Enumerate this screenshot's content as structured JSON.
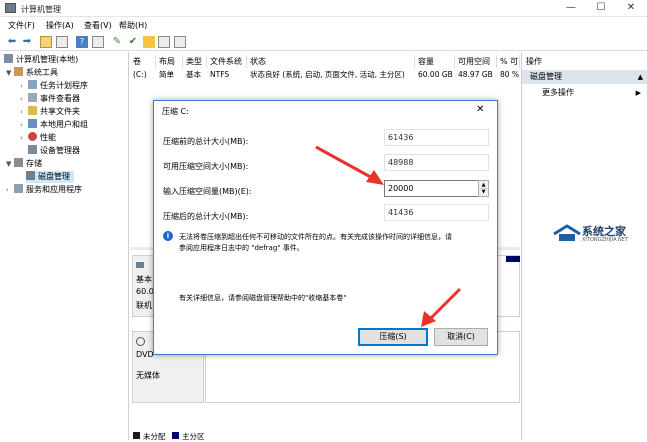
{
  "window": {
    "title": "计算机管理",
    "min": "—",
    "max": "☐",
    "close": "✕"
  },
  "menu": [
    "文件(F)",
    "操作(A)",
    "查看(V)",
    "帮助(H)"
  ],
  "tree": {
    "root": "计算机管理(本地)",
    "system_tools": "系统工具",
    "items": [
      "任务计划程序",
      "事件查看器",
      "共享文件夹",
      "本地用户和组",
      "性能",
      "设备管理器"
    ],
    "storage": "存储",
    "disk_mgmt": "磁盘管理",
    "services": "服务和应用程序"
  },
  "volume_table": {
    "headers": [
      "卷",
      "布局",
      "类型",
      "文件系统",
      "状态",
      "容量",
      "可用空间",
      "% 可"
    ],
    "row": [
      "(C:)",
      "简单",
      "基本",
      "NTFS",
      "状态良好 (系统, 启动, 页面文件, 活动, 主分区)",
      "60.00 GB",
      "48.97 GB",
      "80 %"
    ]
  },
  "disks": {
    "disk0": [
      "基本",
      "60.0",
      "联机"
    ],
    "dvd": [
      "DVD",
      "无媒体"
    ],
    "legend": [
      "未分配",
      "主分区"
    ]
  },
  "actions": {
    "header": "操作",
    "section": "磁盘管理",
    "more": "更多操作",
    "more_arrow": "▶"
  },
  "dialog": {
    "title": "压缩 C:",
    "rows": [
      {
        "label": "压缩前的总计大小(MB):",
        "value": "61436"
      },
      {
        "label": "可用压缩空间大小(MB):",
        "value": "48988"
      },
      {
        "label": "输入压缩空间量(MB)(E):",
        "value": "20000"
      },
      {
        "label": "压缩后的总计大小(MB):",
        "value": "41436"
      }
    ],
    "info_icon": "i",
    "info_text_1": "无法将卷压缩到超出任何不可移动的文件所在的点。有关完成该操作时间的详细信息，请",
    "info_text_2": "参阅应用程序日志中的 \"defrag\" 事件。",
    "help_text": "有关详细信息，请参阅磁盘管理帮助中的\"收缩基本卷\"",
    "shrink_button": "压缩(S)",
    "cancel_button": "取消(C)",
    "close": "✕"
  },
  "watermark": {
    "brand": "系统之家",
    "url": "XITONGZHIJIA.NET"
  },
  "colors": {
    "accent": "#0078d7",
    "arrow": "#e8322c",
    "disk_bar": "#00006a",
    "selected": "#cce8ff"
  }
}
